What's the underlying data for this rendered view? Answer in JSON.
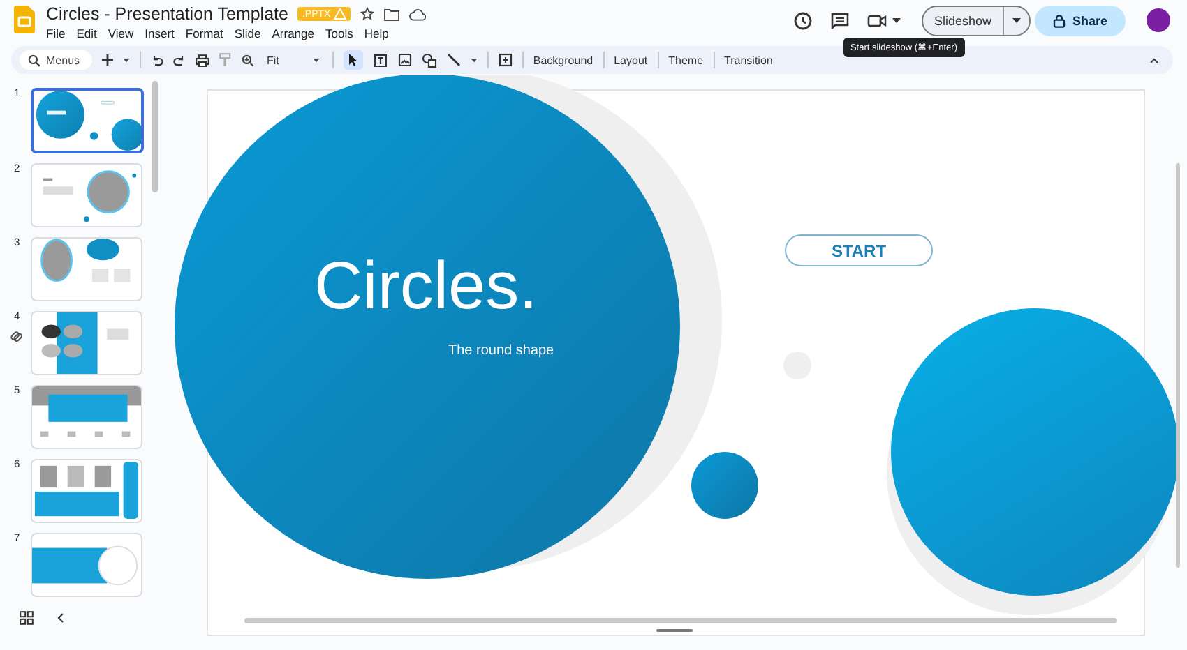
{
  "document": {
    "title": "Circles - Presentation Template",
    "badge": ".PPTX"
  },
  "menu": [
    "File",
    "Edit",
    "View",
    "Insert",
    "Format",
    "Slide",
    "Arrange",
    "Tools",
    "Help"
  ],
  "toolbar": {
    "search_placeholder": "Menus",
    "zoom": "Fit",
    "buttons": [
      "Background",
      "Layout",
      "Theme",
      "Transition"
    ]
  },
  "header_actions": {
    "slideshow": "Slideshow",
    "tooltip": "Start slideshow (⌘+Enter)",
    "share": "Share"
  },
  "slides": [
    {
      "number": "1",
      "kind": "title",
      "selected": true
    },
    {
      "number": "2",
      "kind": "image-right",
      "selected": false
    },
    {
      "number": "3",
      "kind": "image-left",
      "selected": false
    },
    {
      "number": "4",
      "kind": "grid",
      "selected": false
    },
    {
      "number": "5",
      "kind": "banner",
      "selected": false
    },
    {
      "number": "6",
      "kind": "columns",
      "selected": false
    },
    {
      "number": "7",
      "kind": "gallery",
      "selected": false
    }
  ],
  "slide": {
    "title": "Circles.",
    "subtitle": "The round shape",
    "button": "START"
  }
}
